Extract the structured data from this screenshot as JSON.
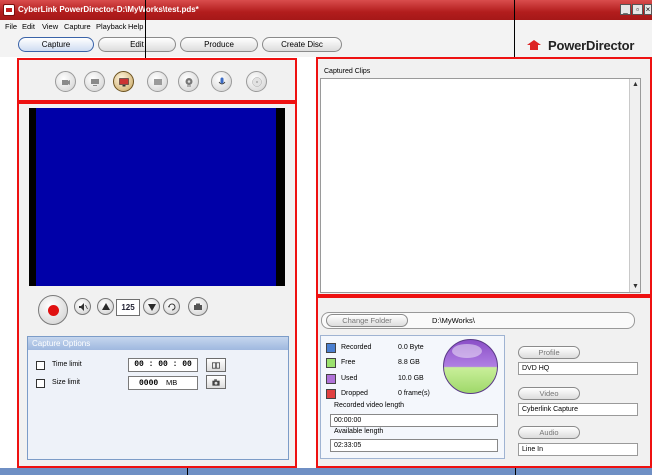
{
  "window": {
    "title": "CyberLink PowerDirector-D:\\MyWorks\\test.pds*",
    "buttons": [
      "minimize",
      "restore",
      "close"
    ]
  },
  "menu": [
    "File",
    "Edit",
    "View",
    "Capture",
    "Playback",
    "Help"
  ],
  "modes": [
    {
      "label": "Capture",
      "active": true
    },
    {
      "label": "Edit",
      "active": false
    },
    {
      "label": "Produce",
      "active": false
    },
    {
      "label": "Create Disc",
      "active": false
    }
  ],
  "brand": "PowerDirector",
  "capture_devices": [
    {
      "icon": "dv-camcorder-icon",
      "active": false
    },
    {
      "icon": "tv-tuner-icon",
      "active": false
    },
    {
      "icon": "webcam-monitor-icon",
      "active": true
    },
    {
      "icon": "digital-tv-icon",
      "active": false
    },
    {
      "icon": "webcam-icon",
      "active": false
    },
    {
      "icon": "microphone-icon",
      "active": false
    },
    {
      "icon": "cd-icon",
      "active": false
    }
  ],
  "controls": {
    "channel": "125",
    "icons": [
      "record-icon",
      "mute-icon",
      "channel-up-icon",
      "channel-down-icon",
      "refresh-icon",
      "snapshot-icon"
    ]
  },
  "capture_options": {
    "header": "Capture Options",
    "time_limit": {
      "label": "Time limit",
      "value": "00 : 00 : 00",
      "checked": false
    },
    "size_limit": {
      "label": "Size limit",
      "value": "0000",
      "unit": "MB",
      "checked": false
    }
  },
  "clips": {
    "label": "Captured Clips"
  },
  "folder": {
    "button": "Change Folder",
    "path": "D:\\MyWorks\\"
  },
  "space": {
    "legend": [
      {
        "label": "Recorded",
        "value": "0.0  Byte",
        "color": "#4a7fd0"
      },
      {
        "label": "Free",
        "value": "8.8  GB",
        "color": "#9be26e"
      },
      {
        "label": "Used",
        "value": "10.0  GB",
        "color": "#b072d8"
      },
      {
        "label": "Dropped",
        "value": "0 frame(s)",
        "color": "#e04040"
      }
    ],
    "recorded_length_label": "Recorded video length",
    "recorded_length": "00:00:00",
    "available_length_label": "Available length",
    "available_length": "02:33:05"
  },
  "settings": {
    "profile_button": "Profile",
    "profile_value": "DVD HQ",
    "video_button": "Video",
    "video_value": "Cyberlink Capture",
    "audio_button": "Audio",
    "audio_value": "Line In"
  },
  "colors": {
    "callout_red": "#e11111",
    "preview_blue": "#0000a8"
  }
}
